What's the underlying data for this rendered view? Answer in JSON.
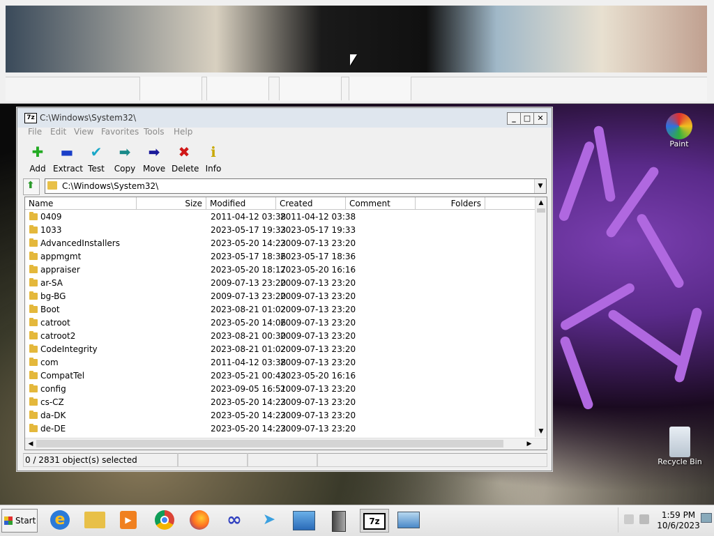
{
  "window": {
    "title": "C:\\Windows\\System32\\",
    "controls": {
      "minimize": "_",
      "maximize": "□",
      "close": "✕"
    }
  },
  "menu": [
    "File",
    "Edit",
    "View",
    "Favorites",
    "Tools",
    "Help"
  ],
  "toolbar": [
    {
      "label": "Add",
      "icon": "plus-icon",
      "color": "#22aa22"
    },
    {
      "label": "Extract",
      "icon": "minus-icon",
      "color": "#1a3fc8"
    },
    {
      "label": "Test",
      "icon": "check-icon",
      "color": "#1aa8c8"
    },
    {
      "label": "Copy",
      "icon": "arrow-right-icon",
      "color": "#1a8a8a"
    },
    {
      "label": "Move",
      "icon": "arrow-right-icon",
      "color": "#1a1a9a"
    },
    {
      "label": "Delete",
      "icon": "x-icon",
      "color": "#d01818"
    },
    {
      "label": "Info",
      "icon": "info-icon",
      "color": "#c8a800"
    }
  ],
  "address": {
    "path": "C:\\Windows\\System32\\"
  },
  "columns": [
    "Name",
    "Size",
    "Modified",
    "Created",
    "Comment",
    "Folders"
  ],
  "rows": [
    {
      "name": "0409",
      "modified": "2011-04-12 03:38",
      "created": "2011-04-12 03:38"
    },
    {
      "name": "1033",
      "modified": "2023-05-17 19:33",
      "created": "2023-05-17 19:33"
    },
    {
      "name": "AdvancedInstallers",
      "modified": "2023-05-20 14:23",
      "created": "2009-07-13 23:20"
    },
    {
      "name": "appmgmt",
      "modified": "2023-05-17 18:36",
      "created": "2023-05-17 18:36"
    },
    {
      "name": "appraiser",
      "modified": "2023-05-20 18:17",
      "created": "2023-05-20 16:16"
    },
    {
      "name": "ar-SA",
      "modified": "2009-07-13 23:20",
      "created": "2009-07-13 23:20"
    },
    {
      "name": "bg-BG",
      "modified": "2009-07-13 23:20",
      "created": "2009-07-13 23:20"
    },
    {
      "name": "Boot",
      "modified": "2023-08-21 01:02",
      "created": "2009-07-13 23:20"
    },
    {
      "name": "catroot",
      "modified": "2023-05-20 14:06",
      "created": "2009-07-13 23:20"
    },
    {
      "name": "catroot2",
      "modified": "2023-08-21 00:30",
      "created": "2009-07-13 23:20"
    },
    {
      "name": "CodeIntegrity",
      "modified": "2023-08-21 01:02",
      "created": "2009-07-13 23:20"
    },
    {
      "name": "com",
      "modified": "2011-04-12 03:38",
      "created": "2009-07-13 23:20"
    },
    {
      "name": "CompatTel",
      "modified": "2023-05-21 00:43",
      "created": "2023-05-20 16:16"
    },
    {
      "name": "config",
      "modified": "2023-09-05 16:51",
      "created": "2009-07-13 23:20"
    },
    {
      "name": "cs-CZ",
      "modified": "2023-05-20 14:23",
      "created": "2009-07-13 23:20"
    },
    {
      "name": "da-DK",
      "modified": "2023-05-20 14:23",
      "created": "2009-07-13 23:20"
    },
    {
      "name": "de-DE",
      "modified": "2023-05-20 14:23",
      "created": "2009-07-13 23:20"
    }
  ],
  "status": {
    "selection": "0 / 2831 object(s) selected"
  },
  "desktop": {
    "paint": "Paint",
    "recycle": "Recycle Bin"
  },
  "taskbar": {
    "start": "Start",
    "time": "1:59 PM",
    "date": "10/6/2023"
  }
}
